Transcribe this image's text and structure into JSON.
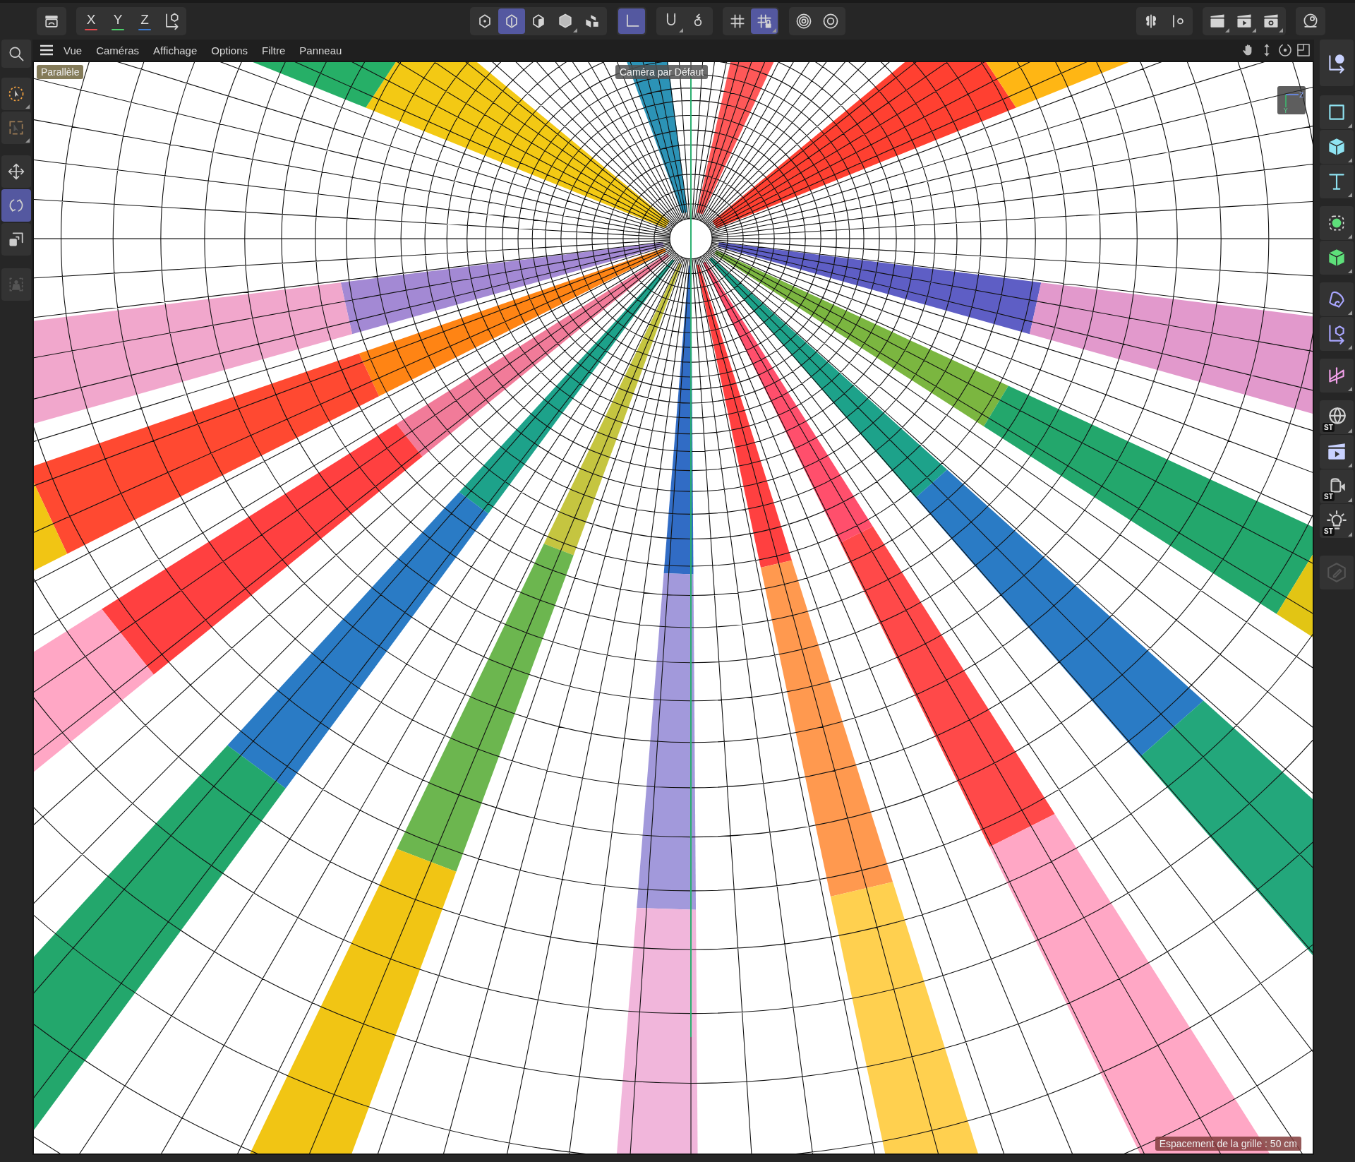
{
  "toolbar": {
    "groups": [
      {
        "buttons": [
          {
            "kind": "history",
            "selected": false,
            "submenu": false
          }
        ]
      },
      {
        "buttons": [
          {
            "kind": "axis-lock",
            "label": "X",
            "color": "#e5484d",
            "selected": false,
            "submenu": false
          },
          {
            "kind": "axis-lock",
            "label": "Y",
            "color": "#4ccf6a",
            "selected": false,
            "submenu": false
          },
          {
            "kind": "axis-lock",
            "label": "Z",
            "color": "#3a7bd5",
            "selected": false,
            "submenu": false
          },
          {
            "kind": "coord-system",
            "selected": false,
            "submenu": false
          }
        ]
      },
      {
        "buttons": [
          {
            "kind": "points",
            "selected": false,
            "submenu": false
          },
          {
            "kind": "edges",
            "selected": true,
            "submenu": false
          },
          {
            "kind": "polygons",
            "selected": false,
            "submenu": false
          },
          {
            "kind": "model",
            "selected": false,
            "submenu": true
          },
          {
            "kind": "texture",
            "selected": false,
            "submenu": false
          }
        ]
      },
      {
        "buttons": [
          {
            "kind": "axis-mode",
            "selected": true,
            "submenu": false
          }
        ]
      },
      {
        "buttons": [
          {
            "kind": "snap",
            "selected": false,
            "submenu": true
          },
          {
            "kind": "snap-settings",
            "selected": false,
            "submenu": false
          }
        ]
      },
      {
        "buttons": [
          {
            "kind": "grid",
            "selected": false,
            "submenu": false
          },
          {
            "kind": "grid-lock",
            "selected": true,
            "submenu": true
          }
        ]
      },
      {
        "buttons": [
          {
            "kind": "target",
            "selected": false,
            "submenu": false
          },
          {
            "kind": "gear-circle",
            "selected": false,
            "submenu": false
          }
        ]
      },
      {
        "buttons": [
          {
            "kind": "symmetry",
            "selected": false,
            "submenu": false
          },
          {
            "kind": "bar-gear",
            "selected": false,
            "submenu": false
          }
        ]
      },
      {
        "buttons": [
          {
            "kind": "clapper",
            "selected": false,
            "submenu": true
          },
          {
            "kind": "clapper-play",
            "selected": false,
            "submenu": true
          },
          {
            "kind": "clapper-gear",
            "selected": false,
            "submenu": true
          }
        ]
      },
      {
        "buttons": [
          {
            "kind": "sphere",
            "selected": false,
            "submenu": false
          }
        ]
      }
    ]
  },
  "menu": [
    "Vue",
    "Caméras",
    "Affichage",
    "Options",
    "Filtre",
    "Panneau"
  ],
  "left_tools": [
    {
      "kind": "live-select",
      "selected": false,
      "disabled": false,
      "submenu": true
    },
    {
      "kind": "box-select",
      "selected": false,
      "disabled": true,
      "submenu": true
    },
    {
      "kind": "move",
      "selected": false,
      "disabled": false,
      "submenu": false
    },
    {
      "kind": "rotate",
      "selected": true,
      "disabled": false,
      "submenu": false
    },
    {
      "kind": "scale",
      "selected": false,
      "disabled": false,
      "submenu": false
    },
    {
      "kind": "weight",
      "selected": false,
      "disabled": true,
      "submenu": false
    }
  ],
  "right_tools": [
    {
      "kind": "null-object",
      "disabled": false,
      "submenu": false
    },
    {
      "kind": "square",
      "disabled": false,
      "submenu": true
    },
    {
      "kind": "cube",
      "disabled": false,
      "submenu": true
    },
    {
      "kind": "text-tool",
      "disabled": false,
      "submenu": true
    },
    {
      "kind": "points-green",
      "disabled": false,
      "submenu": true
    },
    {
      "kind": "cube-green",
      "disabled": false,
      "submenu": true
    },
    {
      "kind": "deformer",
      "disabled": false,
      "submenu": true
    },
    {
      "kind": "axis-cube",
      "disabled": false,
      "submenu": true
    },
    {
      "kind": "bow",
      "disabled": false,
      "submenu": true
    },
    {
      "kind": "globe",
      "badge": "ST",
      "disabled": false,
      "submenu": true
    },
    {
      "kind": "clapper-blue",
      "disabled": false,
      "submenu": true
    },
    {
      "kind": "camera",
      "badge": "ST",
      "disabled": false,
      "submenu": true
    },
    {
      "kind": "light",
      "badge": "ST",
      "disabled": false,
      "submenu": true
    },
    {
      "kind": "pencil",
      "disabled": true,
      "submenu": false
    }
  ],
  "viewport": {
    "projection": "Parallèle",
    "camera": "Caméra par Défaut",
    "axis_labels": [
      "Z",
      "Y"
    ],
    "grid_spacing": "Espacement de la grille : 50 cm"
  }
}
